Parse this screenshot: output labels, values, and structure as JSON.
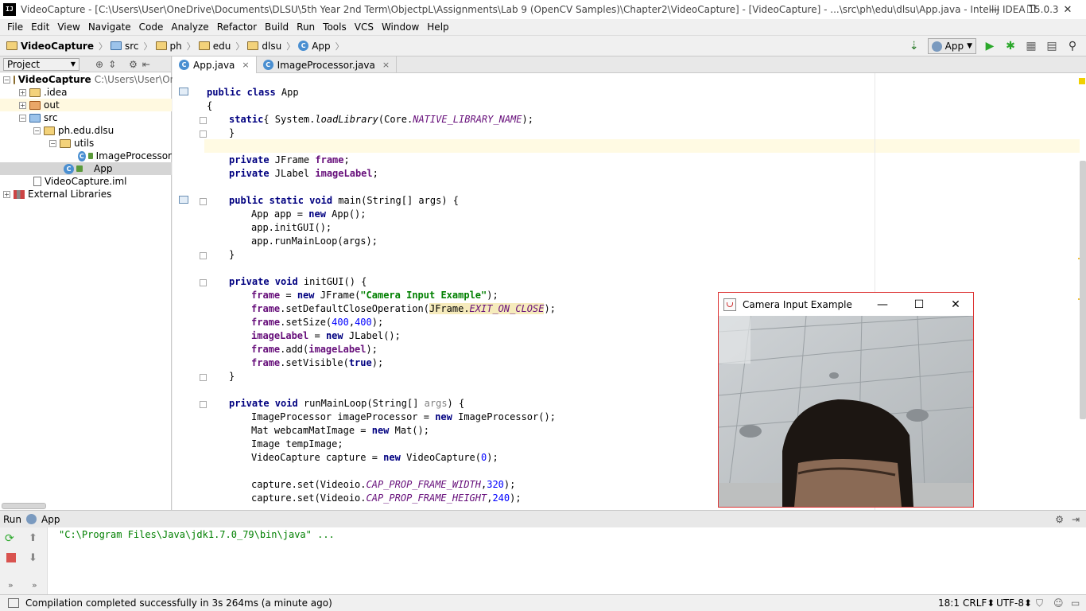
{
  "window": {
    "title": "VideoCapture - [C:\\Users\\User\\OneDrive\\Documents\\DLSU\\5th Year 2nd Term\\ObjectpL\\Assignments\\Lab 9 (OpenCV Samples)\\Chapter2\\VideoCapture] - [VideoCapture] - ...\\src\\ph\\edu\\dlsu\\App.java - IntelliJ IDEA 15.0.3",
    "app_icon_text": "IJ",
    "minimize": "—",
    "restore": "❐",
    "close": "✕"
  },
  "menu": [
    "File",
    "Edit",
    "View",
    "Navigate",
    "Code",
    "Analyze",
    "Refactor",
    "Build",
    "Run",
    "Tools",
    "VCS",
    "Window",
    "Help"
  ],
  "breadcrumbs": [
    "VideoCapture",
    "src",
    "ph",
    "edu",
    "dlsu",
    "App"
  ],
  "run_config": "App",
  "project_panel": {
    "title": "Project",
    "tree": [
      {
        "label": "VideoCapture",
        "extra": "C:\\Users\\User\\OneI"
      },
      {
        "label": ".idea"
      },
      {
        "label": "out"
      },
      {
        "label": "src"
      },
      {
        "label": "ph.edu.dlsu"
      },
      {
        "label": "utils"
      },
      {
        "label": "ImageProcessor"
      },
      {
        "label": "App"
      },
      {
        "label": "VideoCapture.iml"
      },
      {
        "label": "External Libraries"
      }
    ]
  },
  "tabs": [
    {
      "label": "App.java",
      "close": "×"
    },
    {
      "label": "ImageProcessor.java",
      "close": "×"
    }
  ],
  "code": {
    "line1": [
      "public class ",
      "App"
    ],
    "line2": "{",
    "line3": [
      "static",
      "{ System.",
      "loadLibrary",
      "(Core.",
      "NATIVE_LIBRARY_NAME",
      ");"
    ],
    "line4": "}",
    "line6": [
      "private ",
      "JFrame ",
      "frame",
      ";"
    ],
    "line7": [
      "private ",
      "JLabel ",
      "imageLabel",
      ";"
    ],
    "line9": [
      "public static void ",
      "main(String[] args) {"
    ],
    "line10": [
      "App app = ",
      "new ",
      "App();"
    ],
    "line11": "app.initGUI();",
    "line12": "app.runMainLoop(args);",
    "line13": "}",
    "line15": [
      "private void ",
      "initGUI() {"
    ],
    "line16": [
      "frame",
      " = ",
      "new ",
      "JFrame(",
      "\"Camera Input Example\"",
      ");"
    ],
    "line17": [
      "frame",
      ".setDefaultCloseOperation(",
      "JFrame.",
      "EXIT_ON_CLOSE",
      ");"
    ],
    "line18": [
      "frame",
      ".setSize(",
      "400",
      ",",
      "400",
      ");"
    ],
    "line19": [
      "imageLabel",
      " = ",
      "new ",
      "JLabel();"
    ],
    "line20": [
      "frame",
      ".add(",
      "imageLabel",
      ");"
    ],
    "line21": [
      "frame",
      ".setVisible(",
      "true",
      ");"
    ],
    "line22": "}",
    "line24": [
      "private void ",
      "runMainLoop(String[] ",
      "args",
      ") {"
    ],
    "line25": [
      "ImageProcessor imageProcessor = ",
      "new ",
      "ImageProcessor();"
    ],
    "line26": [
      "Mat webcamMatImage = ",
      "new ",
      "Mat();"
    ],
    "line27": "Image tempImage;",
    "line28": [
      "VideoCapture capture = ",
      "new ",
      "VideoCapture(",
      "0",
      ");"
    ],
    "line30": [
      "capture.set(Videoio.",
      "CAP_PROP_FRAME_WIDTH",
      ",",
      "320",
      ");"
    ],
    "line31": [
      "capture.set(Videoio.",
      "CAP_PROP_FRAME_HEIGHT",
      ",",
      "240",
      ");"
    ]
  },
  "run_panel": {
    "label": "Run",
    "config": "App",
    "console": "\"C:\\Program Files\\Java\\jdk1.7.0_79\\bin\\java\" ..."
  },
  "status": {
    "message": "Compilation completed successfully in 3s 264ms (a minute ago)",
    "position": "18:1",
    "line_sep": "CRLF⬍",
    "encoding": "UTF-8⬍"
  },
  "camera_window": {
    "title": "Camera Input Example",
    "minimize": "—",
    "maximize": "☐",
    "close": "✕"
  }
}
